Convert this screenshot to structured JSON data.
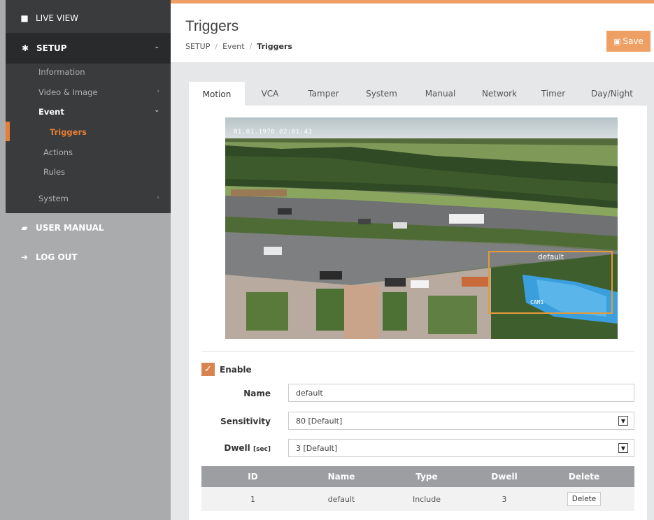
{
  "sidebar": {
    "live_view": "LIVE VIEW",
    "setup": "SETUP",
    "items": {
      "information": "Information",
      "video_image": "Video & Image",
      "event": "Event",
      "triggers": "Triggers",
      "actions": "Actions",
      "rules": "Rules",
      "system": "System"
    },
    "user_manual": "USER MANUAL",
    "log_out": "LOG OUT"
  },
  "header": {
    "title": "Triggers",
    "breadcrumb": [
      "SETUP",
      "Event",
      "Triggers"
    ],
    "save_label": "Save"
  },
  "tabs": [
    "Motion",
    "VCA",
    "Tamper",
    "System",
    "Manual",
    "Network",
    "Timer",
    "Day/Night"
  ],
  "camera": {
    "timestamp": "01.01.1970 02:01:43",
    "region_label": "default",
    "cam_label": "CAM1"
  },
  "form": {
    "enable_label": "Enable",
    "name_label": "Name",
    "name_value": "default",
    "sensitivity_label": "Sensitivity",
    "sensitivity_value": "80 [Default]",
    "dwell_label": "Dwell",
    "dwell_unit": "[sec]",
    "dwell_value": "3 [Default]"
  },
  "table": {
    "headers": [
      "ID",
      "Name",
      "Type",
      "Dwell",
      "Delete"
    ],
    "rows": [
      {
        "id": "1",
        "name": "default",
        "type": "Include",
        "dwell": "3",
        "delete_label": "Delete"
      }
    ]
  },
  "colors": {
    "accent": "#e67e35",
    "save": "#eea064",
    "sidebar_dark": "#393b3d",
    "sidebar_light": "#a9abad"
  }
}
